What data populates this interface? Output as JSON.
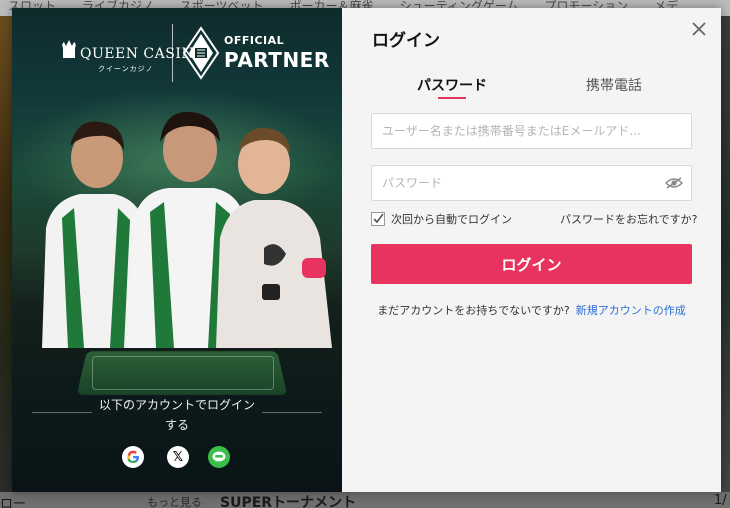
{
  "background": {
    "top_nav": [
      "スロット",
      "ライブカジノ",
      "スポーツベット",
      "ポーカー＆麻雀",
      "シューティングゲーム",
      "プロモーション",
      "メデ"
    ],
    "bottom": {
      "left": "ロー",
      "more": "もっと見る",
      "section": "SUPERトーナメント",
      "right": "1/"
    }
  },
  "promo": {
    "brand": "QUEEN CASINO",
    "brand_sub": "クイーンカジノ",
    "partner_top": "OFFICIAL",
    "partner_main": "PARTNER",
    "social_login_text_line1": "以下のアカウントでログイン",
    "social_login_text_line2": "する",
    "social_icons": [
      "google-icon",
      "x-icon",
      "line-icon"
    ]
  },
  "login": {
    "title": "ログイン",
    "tabs": [
      {
        "label": "パスワード",
        "active": true
      },
      {
        "label": "携帯電話",
        "active": false
      }
    ],
    "username_placeholder": "ユーザー名または携帯番号またはEメールアド...",
    "password_placeholder": "パスワード",
    "remember_label": "次回から自動でログイン",
    "forgot_label": "パスワードをお忘れですか?",
    "submit_label": "ログイン",
    "signup_prompt": "まだアカウントをお持ちでないですか?",
    "signup_link": "新規アカウントの作成",
    "accent_color": "#e8335e",
    "link_color": "#2b6fd6"
  }
}
